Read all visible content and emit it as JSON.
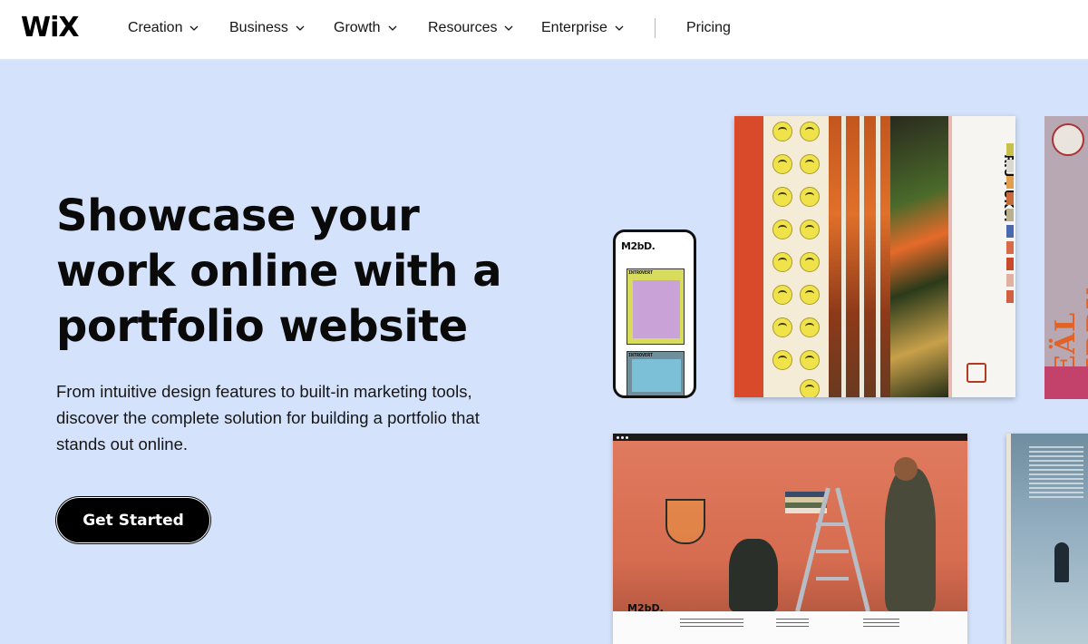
{
  "header": {
    "logo": "WiX",
    "nav": [
      {
        "label": "Creation"
      },
      {
        "label": "Business"
      },
      {
        "label": "Growth"
      },
      {
        "label": "Resources"
      },
      {
        "label": "Enterprise"
      }
    ],
    "pricing": "Pricing"
  },
  "hero": {
    "headline_line1": "Showcase your",
    "headline_line2": "work online with a",
    "headline_line3": "portfolio website",
    "subtext": "From intuitive design features to built-in marketing tools, discover the complete solution for building a portfolio that stands out online.",
    "cta": "Get Started"
  },
  "mockups": {
    "phone_logo": "M2bD.",
    "phone_card1_title": "INTROVERT",
    "phone_card2_title": "INTROVERT",
    "poster_name": "RIU FUKUI",
    "right_poster_title": "REÄL PERDY",
    "site_logo": "M2bD."
  },
  "colors": {
    "hero_bg": "#d4e2fb",
    "cta_bg": "#000000",
    "cta_text": "#ffffff"
  }
}
